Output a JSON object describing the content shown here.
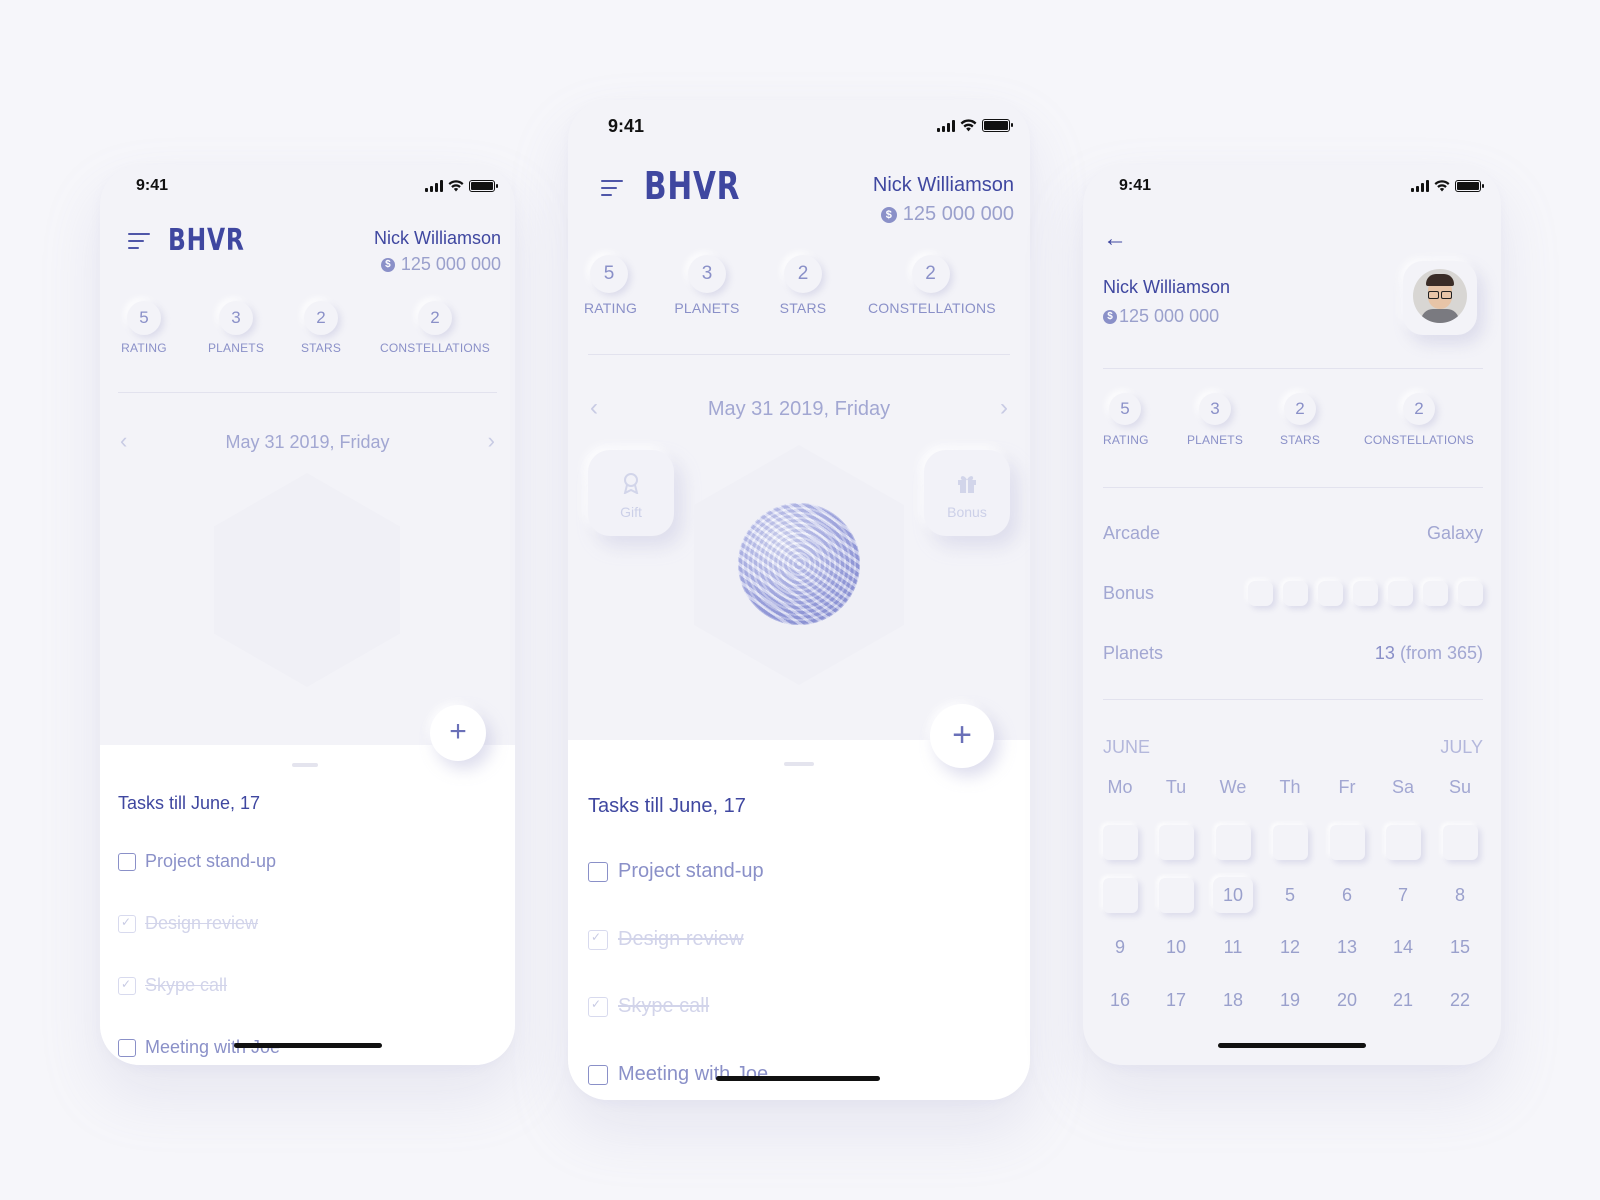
{
  "status": {
    "time": "9:41"
  },
  "app": {
    "logo": "BHVR",
    "user_name": "Nick Williamson",
    "balance": "125 000 000",
    "coin_symbol": "$"
  },
  "stats": [
    {
      "value": "5",
      "label": "RATING"
    },
    {
      "value": "3",
      "label": "PLANETS"
    },
    {
      "value": "2",
      "label": "STARS"
    },
    {
      "value": "2",
      "label": "CONSTELLATIONS"
    }
  ],
  "date": {
    "label": "May 31 2019, Friday",
    "prev": "‹",
    "next": "›"
  },
  "side_buttons": {
    "gift": {
      "label": "Gift",
      "icon": "award-icon"
    },
    "bonus": {
      "label": "Bonus",
      "icon": "gift-icon"
    }
  },
  "tasks": {
    "title": "Tasks till June, 17",
    "add": "+",
    "items": [
      {
        "label": "Project stand-up",
        "done": false
      },
      {
        "label": "Design review",
        "done": true
      },
      {
        "label": "Skype call",
        "done": true
      },
      {
        "label": "Meeting with Joe",
        "done": false
      }
    ]
  },
  "profile": {
    "back": "←",
    "rows": {
      "arcade_label": "Arcade",
      "arcade_value": "Galaxy",
      "bonus_label": "Bonus",
      "planets_label": "Planets",
      "planets_value": "13",
      "planets_suffix": "(from 365)"
    },
    "calendar": {
      "month_left": "JUNE",
      "month_right": "JULY",
      "weekdays": [
        "Mo",
        "Tu",
        "We",
        "Th",
        "Fr",
        "Sa",
        "Su"
      ],
      "row2": [
        "10",
        "5",
        "6",
        "7",
        "8"
      ],
      "row3": [
        "9",
        "10",
        "11",
        "12",
        "13",
        "14",
        "15"
      ],
      "row4": [
        "16",
        "17",
        "18",
        "19",
        "20",
        "21",
        "22"
      ]
    }
  }
}
